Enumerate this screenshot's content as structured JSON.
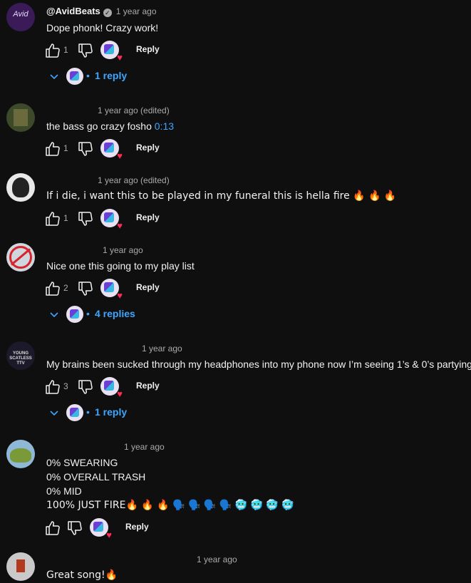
{
  "comments": [
    {
      "author": "@AvidBeats",
      "verified": true,
      "time": "1 year ago",
      "lines": [
        "Dope phonk! Crazy work!"
      ],
      "likes": "1",
      "reply_label": "Reply",
      "replies_label": "1 reply",
      "avatar_text": "Avid"
    },
    {
      "author": "",
      "time": "1 year ago (edited)",
      "text_before": "the bass go crazy fosho ",
      "timestamp_link": "0:13",
      "likes": "1",
      "reply_label": "Reply"
    },
    {
      "author": "",
      "time": "1 year ago (edited)",
      "lines": [
        "If i die, i want this to be played in my funeral this is hella fire 🔥 🔥 🔥"
      ],
      "likes": "1",
      "reply_label": "Reply"
    },
    {
      "author": "",
      "time": "1 year ago",
      "lines": [
        "Nice one this going to my play list"
      ],
      "likes": "2",
      "reply_label": "Reply",
      "replies_label": "4 replies"
    },
    {
      "author": "",
      "time": "1 year ago",
      "lines": [
        "My brains been sucked through my headphones into my phone now I’m seeing 1’s & 0’s partying"
      ],
      "likes": "3",
      "reply_label": "Reply",
      "replies_label": "1 reply",
      "avatar_text": "YOUNG SCATLESS TTV"
    },
    {
      "author": "",
      "time": "1 year ago",
      "lines": [
        "0% SWEARING",
        "0% OVERALL TRASH",
        "0% MID",
        "100% JUST FIRE🔥 🔥 🔥 🗣️ 🗣️ 🗣️ 🗣️ 🥶 🥶 🥶 🥶"
      ],
      "reply_label": "Reply"
    },
    {
      "author": "",
      "time": "1 year ago",
      "lines": [
        "Great song!🔥"
      ]
    }
  ],
  "colors": {
    "background": "#0f0f0f",
    "text": "#f1f1f1",
    "secondary": "#aaaaaa",
    "link": "#3ea6ff",
    "heart": "#ff2a55"
  },
  "icons": [
    "thumbs-up-icon",
    "thumbs-down-icon",
    "creator-heart-icon",
    "chevron-down-icon",
    "verified-check-icon"
  ]
}
